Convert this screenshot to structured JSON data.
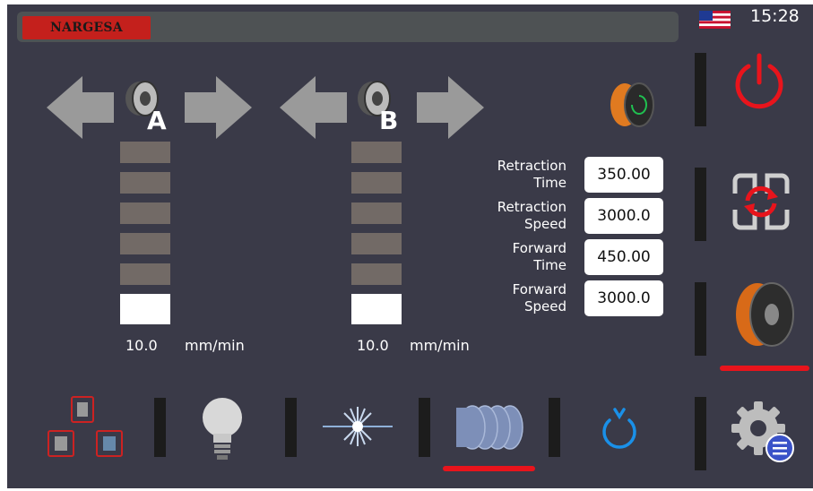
{
  "header": {
    "brand": "NARGESA",
    "time": "15:28"
  },
  "units": "mm/min",
  "feeders": [
    {
      "label": "A",
      "speed": "10.0",
      "active_segments": 1,
      "total_segments": 6
    },
    {
      "label": "B",
      "speed": "10.0",
      "active_segments": 1,
      "total_segments": 6
    }
  ],
  "params": [
    {
      "label_l1": "Retraction",
      "label_l2": "Time",
      "value": "350.00"
    },
    {
      "label_l1": "Retraction",
      "label_l2": "Speed",
      "value": "3000.0"
    },
    {
      "label_l1": "Forward",
      "label_l2": "Time",
      "value": "450.00"
    },
    {
      "label_l1": "Forward",
      "label_l2": "Speed",
      "value": "3000.0"
    }
  ],
  "colors": {
    "accent_red": "#e8141c",
    "background": "#3a3a48",
    "power_blue": "#1a90e8"
  },
  "icons": {
    "left_arrow": "left-arrow-icon",
    "right_arrow": "right-arrow-icon",
    "spool": "spool-icon",
    "power": "power-icon",
    "reset": "reset-icon",
    "settings": "settings-gear-icon",
    "bulb": "bulb-icon",
    "laser": "laser-icon",
    "rollers": "rollers-icon",
    "standby": "standby-icon"
  },
  "active_tabs": [
    "spool-side-button",
    "rollers-button"
  ]
}
